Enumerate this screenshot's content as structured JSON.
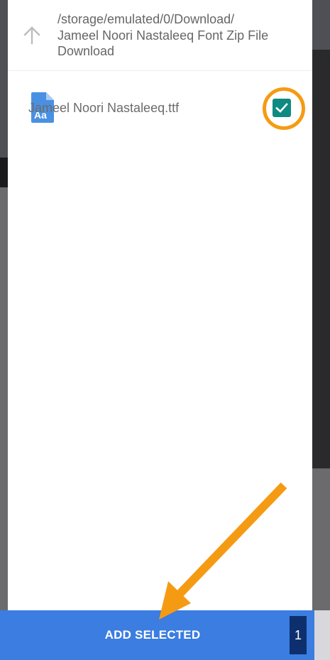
{
  "dialog": {
    "path": {
      "icon": "arrow-up-icon",
      "text": "/storage/emulated/0/Download/\nJameel Noori Nastaleeq Font Zip File\nDownload"
    },
    "files": [
      {
        "icon": "font-file-icon",
        "name": "Jameel Noori Nastaleeq.ttf",
        "checked": true
      }
    ],
    "footer": {
      "add_label": "ADD SELECTED",
      "count": "1"
    }
  },
  "colors": {
    "accent_button": "#3b7de0",
    "checkbox": "#0f8a80",
    "badge": "#0d2f6e",
    "annotation": "#f59b13",
    "file_icon": "#4a90e2"
  }
}
